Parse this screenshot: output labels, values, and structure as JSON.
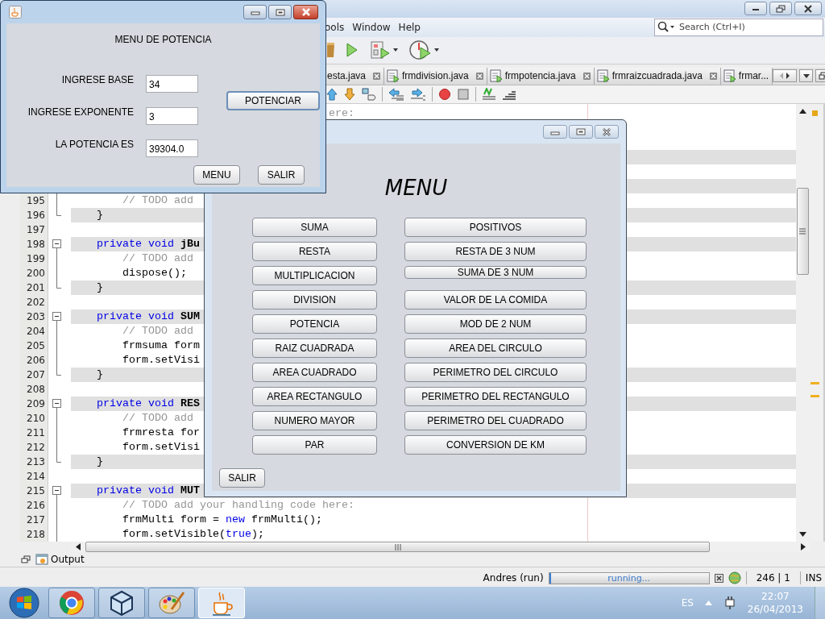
{
  "ide": {
    "menu": [
      "ools",
      "Window",
      "Help"
    ],
    "search": {
      "placeholder": "Search (Ctrl+I)"
    },
    "tabs": [
      {
        "label": "esta.java",
        "selected": false,
        "closable": true
      },
      {
        "label": "frmdivision.java",
        "selected": false,
        "closable": true
      },
      {
        "label": "frmpotencia.java",
        "selected": false,
        "closable": true
      },
      {
        "label": "frmraizcuadrada.java",
        "selected": false,
        "closable": true
      },
      {
        "label": "frmar...",
        "selected": false,
        "closable": false
      }
    ],
    "progress": {
      "level": 0.01
    },
    "code_lines": [
      {
        "highlighted": false,
        "tokens": [
          {
            "text": "                                        ere:",
            "kind": "comment"
          }
        ]
      },
      {
        "highlighted": false
      },
      {
        "highlighted": false
      },
      {
        "highlighted": true
      },
      {
        "highlighted": false
      },
      {
        "highlighted": true
      },
      {
        "number": "195",
        "highlighted": false,
        "kind": "inside",
        "tokens": [
          {
            "text": "        // TODO add",
            "kind": "comment"
          }
        ]
      },
      {
        "number": "196",
        "highlighted": true,
        "kind": "end",
        "tokens": [
          {
            "text": "    }",
            "kind": "plain"
          }
        ]
      },
      {
        "number": "197",
        "highlighted": false
      },
      {
        "number": "198",
        "highlighted": true,
        "kind": "start",
        "tokens": [
          {
            "text": "    private void ",
            "kind": "keyword"
          },
          {
            "text": "jBu",
            "kind": "method"
          }
        ]
      },
      {
        "number": "199",
        "highlighted": false,
        "kind": "inside",
        "tokens": [
          {
            "text": "        // TODO add",
            "kind": "comment"
          }
        ]
      },
      {
        "number": "200",
        "highlighted": false,
        "kind": "inside",
        "tokens": [
          {
            "text": "        dispose();",
            "kind": "plain"
          }
        ]
      },
      {
        "number": "201",
        "highlighted": true,
        "kind": "end",
        "tokens": [
          {
            "text": "    }",
            "kind": "plain"
          }
        ]
      },
      {
        "number": "202",
        "highlighted": false
      },
      {
        "number": "203",
        "highlighted": true,
        "kind": "start",
        "tokens": [
          {
            "text": "    private void ",
            "kind": "keyword"
          },
          {
            "text": "SUM",
            "kind": "method"
          }
        ]
      },
      {
        "number": "204",
        "highlighted": false,
        "kind": "inside",
        "tokens": [
          {
            "text": "        // TODO add",
            "kind": "comment"
          }
        ]
      },
      {
        "number": "205",
        "highlighted": false,
        "kind": "inside",
        "tokens": [
          {
            "text": "        frmsuma form",
            "kind": "plain"
          }
        ]
      },
      {
        "number": "206",
        "highlighted": false,
        "kind": "inside",
        "tokens": [
          {
            "text": "        form.setVisi",
            "kind": "plain"
          }
        ]
      },
      {
        "number": "207",
        "highlighted": true,
        "kind": "end",
        "tokens": [
          {
            "text": "    }",
            "kind": "plain"
          }
        ]
      },
      {
        "number": "208",
        "highlighted": false
      },
      {
        "number": "209",
        "highlighted": true,
        "kind": "start",
        "tokens": [
          {
            "text": "    private void ",
            "kind": "keyword"
          },
          {
            "text": "RES",
            "kind": "method"
          }
        ]
      },
      {
        "number": "210",
        "highlighted": false,
        "kind": "inside",
        "tokens": [
          {
            "text": "        // TODO add",
            "kind": "comment"
          }
        ]
      },
      {
        "number": "211",
        "highlighted": false,
        "kind": "inside",
        "tokens": [
          {
            "text": "        frmresta for",
            "kind": "plain"
          }
        ]
      },
      {
        "number": "212",
        "highlighted": false,
        "kind": "inside",
        "tokens": [
          {
            "text": "        form.setVisi",
            "kind": "plain"
          }
        ]
      },
      {
        "number": "213",
        "highlighted": true,
        "kind": "end",
        "tokens": [
          {
            "text": "    }",
            "kind": "plain"
          }
        ]
      },
      {
        "number": "214",
        "highlighted": false
      },
      {
        "number": "215",
        "highlighted": true,
        "kind": "start",
        "tokens": [
          {
            "text": "    private void ",
            "kind": "keyword"
          },
          {
            "text": "MUT",
            "kind": "method"
          }
        ]
      },
      {
        "number": "216",
        "highlighted": false,
        "kind": "inside",
        "tokens": [
          {
            "text": "        // TODO add your handling code here:",
            "kind": "comment"
          }
        ]
      },
      {
        "number": "217",
        "highlighted": false,
        "kind": "inside",
        "tokens": [
          {
            "text": "        frmMulti form = ",
            "kind": "plain"
          },
          {
            "text": "new",
            "kind": "keyword"
          },
          {
            "text": " frmMulti();",
            "kind": "plain"
          }
        ]
      },
      {
        "number": "218",
        "highlighted": false,
        "kind": "inside",
        "tokens": [
          {
            "text": "        form.setVisible(",
            "kind": "plain"
          },
          {
            "text": "true",
            "kind": "keyword"
          },
          {
            "text": ");",
            "kind": "plain"
          }
        ]
      }
    ],
    "output_tab": "Output",
    "status": {
      "project": "Andres (run)",
      "progress_text": "running...",
      "position": "246 | 1",
      "mode": "INS"
    }
  },
  "taskbar": {
    "apps": [
      {
        "selected": false
      },
      {
        "selected": false
      },
      {
        "selected": false
      },
      {
        "selected": true
      }
    ],
    "language": "ES",
    "time": "22:07",
    "date": "26/04/2013"
  },
  "potencia_window": {
    "title": "MENU DE POTENCIA",
    "fields": [
      {
        "label": "INGRESE BASE",
        "value": "34"
      },
      {
        "label": "INGRESE EXPONENTE",
        "value": "3"
      },
      {
        "label": "LA POTENCIA ES",
        "value": "39304.0"
      }
    ],
    "action": {
      "label": "POTENCIAR",
      "focused": true
    },
    "buttons": [
      "MENU",
      "SALIR"
    ]
  },
  "menu_window": {
    "title": "MENU",
    "left_column": [
      {
        "label": "SUMA",
        "kind": "normal"
      },
      {
        "label": "RESTA",
        "kind": "normal"
      },
      {
        "label": "MULTIPLICACION",
        "kind": "normal"
      },
      {
        "label": "DIVISION",
        "kind": "normal"
      },
      {
        "label": "POTENCIA",
        "kind": "normal"
      },
      {
        "label": "RAIZ CUADRADA",
        "kind": "normal"
      },
      {
        "label": "AREA CUADRADO",
        "kind": "normal"
      },
      {
        "label": "AREA RECTANGULO",
        "kind": "normal"
      },
      {
        "label": "NUMERO MAYOR",
        "kind": "normal"
      },
      {
        "label": "PAR",
        "kind": "normal"
      }
    ],
    "right_column": [
      {
        "label": "POSITIVOS",
        "kind": "normal"
      },
      {
        "label": "RESTA DE 3 NUM",
        "kind": "normal"
      },
      {
        "label": "SUMA DE 3 NUM",
        "kind": "compact"
      },
      {
        "label": "VALOR DE LA COMIDA",
        "kind": "normal"
      },
      {
        "label": "MOD DE 2 NUM",
        "kind": "normal"
      },
      {
        "label": "AREA DEL CIRCULO",
        "kind": "normal"
      },
      {
        "label": "PERIMETRO DEL CIRCULO",
        "kind": "normal"
      },
      {
        "label": "PERIMETRO DEL RECTANGULO",
        "kind": "normal"
      },
      {
        "label": "PERIMETRO DEL CUADRADO",
        "kind": "normal"
      },
      {
        "label": "CONVERSION DE KM",
        "kind": "normal"
      }
    ],
    "exit": "SALIR"
  }
}
